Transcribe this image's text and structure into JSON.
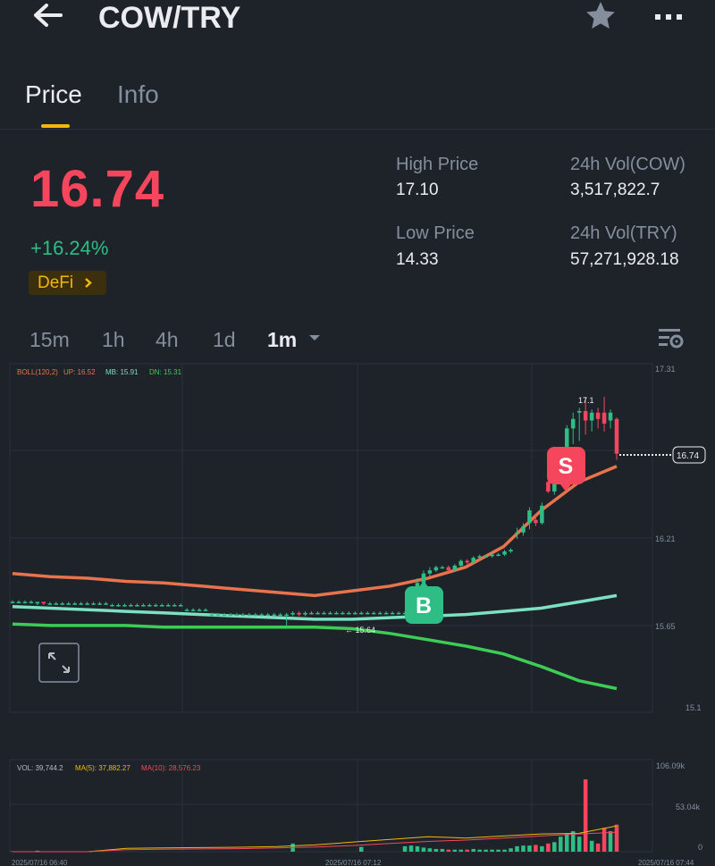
{
  "header": {
    "title": "COW/TRY"
  },
  "tabs": [
    {
      "label": "Price"
    },
    {
      "label": "Info"
    }
  ],
  "ticker": {
    "last_price": "16.74",
    "change_pct": "+16.24%",
    "tag": "DeFi",
    "high_label": "High Price",
    "high_value": "17.10",
    "low_label": "Low Price",
    "low_value": "14.33",
    "vol_base_label": "24h Vol(COW)",
    "vol_base_value": "3,517,822.7",
    "vol_quote_label": "24h Vol(TRY)",
    "vol_quote_value": "57,271,928.18"
  },
  "intervals": [
    {
      "label": "15m"
    },
    {
      "label": "1h"
    },
    {
      "label": "4h"
    },
    {
      "label": "1d"
    },
    {
      "label": "1m"
    }
  ],
  "selected_interval": "1m",
  "colors": {
    "up": "#2ebd85",
    "down": "#f6465d",
    "accent": "#f0b90b",
    "upper_band": "#e8734d",
    "mid_band": "#7ee0c2",
    "lower_band": "#3dcc55"
  },
  "indicators": {
    "boll": {
      "label": "BOLL(120,2)",
      "up": "UP: 16.52",
      "mb": "MB: 15.91",
      "dn": "DN: 15.31"
    },
    "vol": {
      "vol": "VOL: 39,744.2",
      "ma5": "MA(5): 37,882.27",
      "ma10": "MA(10): 28,576.23"
    }
  },
  "markers": {
    "buy": "B",
    "sell": "S",
    "high_label": "17.1",
    "low_label": "← 15.64",
    "last_price_label": "16.74"
  },
  "chart_data": {
    "type": "candlestick",
    "price_axis_ticks": [
      "17.31",
      "16.21",
      "15.65",
      "15.1"
    ],
    "volume_axis_ticks": [
      "106.09k",
      "53.04k",
      "0"
    ],
    "time_ticks": [
      "2025/07/16 06:40",
      "2025/07/16 07:12",
      "2025/07/16 07:44"
    ],
    "ylim": [
      15.1,
      17.31
    ],
    "candles": [
      [
        15.8,
        15.8,
        15.81,
        15.79
      ],
      [
        15.8,
        15.8,
        15.81,
        15.79
      ],
      [
        15.8,
        15.8,
        15.81,
        15.79
      ],
      [
        15.8,
        15.8,
        15.81,
        15.79
      ],
      [
        15.79,
        15.8,
        15.8,
        15.78
      ],
      [
        15.8,
        15.79,
        15.8,
        15.78
      ],
      [
        15.79,
        15.79,
        15.8,
        15.78
      ],
      [
        15.79,
        15.79,
        15.8,
        15.78
      ],
      [
        15.79,
        15.79,
        15.8,
        15.78
      ],
      [
        15.79,
        15.79,
        15.8,
        15.78
      ],
      [
        15.79,
        15.79,
        15.8,
        15.78
      ],
      [
        15.79,
        15.79,
        15.8,
        15.78
      ],
      [
        15.79,
        15.79,
        15.8,
        15.78
      ],
      [
        15.79,
        15.79,
        15.8,
        15.78
      ],
      [
        15.79,
        15.79,
        15.8,
        15.78
      ],
      [
        15.79,
        15.79,
        15.8,
        15.78
      ],
      [
        15.78,
        15.78,
        15.79,
        15.77
      ],
      [
        15.78,
        15.78,
        15.79,
        15.77
      ],
      [
        15.78,
        15.78,
        15.79,
        15.77
      ],
      [
        15.78,
        15.78,
        15.79,
        15.77
      ],
      [
        15.78,
        15.78,
        15.79,
        15.77
      ],
      [
        15.78,
        15.78,
        15.79,
        15.77
      ],
      [
        15.78,
        15.78,
        15.79,
        15.77
      ],
      [
        15.78,
        15.78,
        15.79,
        15.77
      ],
      [
        15.78,
        15.78,
        15.79,
        15.77
      ],
      [
        15.78,
        15.78,
        15.79,
        15.77
      ],
      [
        15.78,
        15.78,
        15.79,
        15.77
      ],
      [
        15.78,
        15.78,
        15.79,
        15.77
      ],
      [
        15.75,
        15.75,
        15.76,
        15.74
      ],
      [
        15.75,
        15.75,
        15.76,
        15.74
      ],
      [
        15.75,
        15.75,
        15.76,
        15.74
      ],
      [
        15.75,
        15.75,
        15.76,
        15.74
      ],
      [
        15.72,
        15.72,
        15.73,
        15.71
      ],
      [
        15.72,
        15.72,
        15.73,
        15.71
      ],
      [
        15.72,
        15.72,
        15.73,
        15.71
      ],
      [
        15.72,
        15.72,
        15.73,
        15.71
      ],
      [
        15.72,
        15.72,
        15.73,
        15.71
      ],
      [
        15.72,
        15.72,
        15.73,
        15.71
      ],
      [
        15.72,
        15.72,
        15.73,
        15.71
      ],
      [
        15.72,
        15.72,
        15.73,
        15.71
      ],
      [
        15.72,
        15.72,
        15.73,
        15.71
      ],
      [
        15.72,
        15.72,
        15.73,
        15.71
      ],
      [
        15.72,
        15.72,
        15.73,
        15.71
      ],
      [
        15.72,
        15.72,
        15.73,
        15.71
      ],
      [
        15.72,
        15.72,
        15.73,
        15.64
      ],
      [
        15.72,
        15.73,
        15.74,
        15.71
      ],
      [
        15.73,
        15.72,
        15.74,
        15.71
      ],
      [
        15.72,
        15.73,
        15.74,
        15.71
      ],
      [
        15.73,
        15.73,
        15.74,
        15.72
      ],
      [
        15.73,
        15.73,
        15.74,
        15.72
      ],
      [
        15.73,
        15.73,
        15.74,
        15.72
      ],
      [
        15.73,
        15.73,
        15.74,
        15.72
      ],
      [
        15.73,
        15.73,
        15.74,
        15.72
      ],
      [
        15.73,
        15.73,
        15.74,
        15.72
      ],
      [
        15.73,
        15.73,
        15.74,
        15.72
      ],
      [
        15.73,
        15.73,
        15.74,
        15.72
      ],
      [
        15.73,
        15.73,
        15.74,
        15.72
      ],
      [
        15.73,
        15.73,
        15.74,
        15.72
      ],
      [
        15.73,
        15.73,
        15.74,
        15.72
      ],
      [
        15.73,
        15.73,
        15.74,
        15.72
      ],
      [
        15.73,
        15.73,
        15.74,
        15.72
      ],
      [
        15.73,
        15.73,
        15.74,
        15.72
      ],
      [
        15.73,
        15.73,
        15.74,
        15.72
      ],
      [
        15.73,
        15.73,
        15.74,
        15.72
      ],
      [
        15.79,
        15.84,
        15.86,
        15.78
      ],
      [
        15.84,
        15.92,
        15.95,
        15.83
      ],
      [
        15.92,
        15.98,
        16.0,
        15.9
      ],
      [
        15.98,
        16.0,
        16.02,
        15.96
      ],
      [
        16.0,
        16.02,
        16.03,
        15.99
      ],
      [
        16.02,
        16.02,
        16.03,
        16.01
      ],
      [
        16.02,
        16.0,
        16.03,
        15.99
      ],
      [
        16.0,
        16.03,
        16.04,
        15.99
      ],
      [
        16.03,
        16.06,
        16.07,
        16.02
      ],
      [
        16.06,
        16.05,
        16.07,
        16.04
      ],
      [
        16.05,
        16.08,
        16.09,
        16.04
      ],
      [
        16.08,
        16.09,
        16.1,
        16.07
      ],
      [
        16.09,
        16.09,
        16.1,
        16.08
      ],
      [
        16.09,
        16.1,
        16.11,
        16.08
      ],
      [
        16.1,
        16.1,
        16.11,
        16.09
      ],
      [
        16.1,
        16.12,
        16.13,
        16.09
      ],
      [
        16.12,
        16.13,
        16.14,
        16.11
      ],
      [
        16.24,
        16.24,
        16.27,
        16.2
      ],
      [
        16.24,
        16.28,
        16.3,
        16.22
      ],
      [
        16.3,
        16.38,
        16.4,
        16.26
      ],
      [
        16.32,
        16.3,
        16.35,
        16.28
      ],
      [
        16.3,
        16.41,
        16.43,
        16.29
      ],
      [
        16.56,
        16.5,
        16.57,
        16.49
      ],
      [
        16.5,
        16.55,
        16.57,
        16.48
      ],
      [
        16.62,
        16.68,
        16.7,
        16.6
      ],
      [
        16.7,
        16.9,
        16.92,
        16.66
      ],
      [
        16.9,
        16.96,
        17.0,
        16.8
      ],
      [
        17.0,
        17.01,
        17.03,
        16.82
      ],
      [
        17.01,
        16.95,
        17.1,
        16.86
      ],
      [
        16.95,
        17.0,
        17.02,
        16.88
      ],
      [
        17.0,
        16.96,
        17.03,
        16.9
      ],
      [
        17.0,
        16.93,
        17.1,
        16.88
      ],
      [
        16.95,
        17.0,
        17.02,
        16.9
      ],
      [
        16.96,
        16.74,
        16.97,
        16.7
      ]
    ],
    "boll_upper": [
      15.98,
      15.96,
      15.95,
      15.93,
      15.92,
      15.9,
      15.88,
      15.86,
      15.84,
      15.87,
      15.9,
      15.95,
      16.02,
      16.15,
      16.38,
      16.56,
      16.66
    ],
    "boll_mid": [
      15.77,
      15.76,
      15.75,
      15.74,
      15.73,
      15.72,
      15.71,
      15.7,
      15.69,
      15.69,
      15.7,
      15.71,
      15.72,
      15.74,
      15.76,
      15.8,
      15.84
    ],
    "boll_lower": [
      15.66,
      15.65,
      15.65,
      15.65,
      15.64,
      15.64,
      15.64,
      15.64,
      15.64,
      15.63,
      15.6,
      15.56,
      15.52,
      15.47,
      15.39,
      15.3,
      15.25
    ],
    "volume": [
      600,
      0,
      0,
      0,
      1500,
      0,
      0,
      0,
      0,
      0,
      0,
      0,
      0,
      0,
      0,
      0,
      0,
      0,
      0,
      0,
      0,
      0,
      0,
      0,
      0,
      0,
      0,
      0,
      0,
      0,
      0,
      0,
      0,
      0,
      0,
      0,
      0,
      0,
      0,
      0,
      0,
      0,
      0,
      0,
      0,
      12000,
      0,
      0,
      0,
      0,
      0,
      0,
      0,
      0,
      0,
      0,
      7000,
      0,
      0,
      0,
      0,
      0,
      0,
      8000,
      9000,
      8000,
      6000,
      5000,
      4000,
      4000,
      3000,
      3000,
      3000,
      3000,
      4000,
      3000,
      3000,
      3000,
      3000,
      3000,
      5000,
      8000,
      9000,
      9000,
      10000,
      8000,
      12000,
      14000,
      22000,
      27000,
      30000,
      22000,
      106000,
      16000,
      12000,
      35000,
      30000,
      39744
    ],
    "volume_ma5": [
      0,
      0,
      0,
      5000,
      5500,
      6000,
      6500,
      7500,
      10000,
      14000,
      18000,
      22000,
      20000,
      23000,
      26000,
      27000,
      37882
    ],
    "volume_ma10": [
      0,
      0,
      0,
      3000,
      3500,
      4000,
      4500,
      5500,
      7000,
      9000,
      12000,
      15000,
      17000,
      20000,
      23000,
      26000,
      28576
    ]
  }
}
